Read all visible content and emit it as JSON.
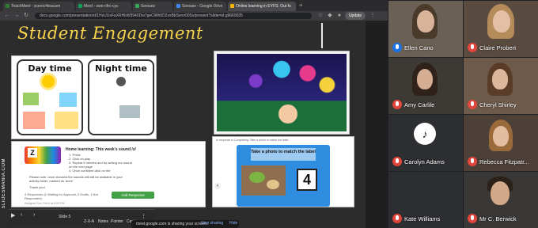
{
  "browser": {
    "tabs": [
      {
        "label": "TeachMeet - scenic4teacam",
        "color": "#2e7d32"
      },
      {
        "label": "Meet - swe-nfrc-cyc",
        "color": "#0f9d58"
      },
      {
        "label": "Seesaw",
        "color": "#34a853"
      },
      {
        "label": "Seesaw - Google Drive",
        "color": "#4285f4"
      },
      {
        "label": "Online learning in EYFS: Out fo",
        "color": "#f4b400"
      }
    ],
    "address": "docs.google.com/presentation/d/1HxUUxFaXRHkW9940Dw7geCWh6D2xxBbSvnn00Sv/present?slide=id.g9669035",
    "update_label": "Update"
  },
  "slide": {
    "title": "Student Engagement",
    "day_label": "Day time",
    "night_label": "Night time",
    "home_learning_title": "Home learning: This week's sound /z/",
    "home_learning_lines": [
      "1. Press",
      "2. Click on play",
      "3. Repeat if needed and try writing our sound on the next page",
      "4. Once confident click on the"
    ],
    "home_learning_footer": "Please note: once checked the sounds will still be available in your activity folder, marked as 'done'",
    "thank_you": "Thank you!",
    "responses_text": "4 Responses (1 Waiting for Approval, 0 Drafts, 1 Not Responded)",
    "add_response_label": "Add Response",
    "assigned_text": "Assigned Sun, Feb 6 at 6:00 PM",
    "response_caption": "In response to Completing: Take a photo to match the label",
    "photo_prompt": "Take a photo to match the label",
    "photo_number": "4",
    "side_label": "SLIDESMANIA.COM",
    "slide_number_label": "Slide 5"
  },
  "slide_toolbar": [
    "Z-X-A",
    "Notes",
    "Pointer",
    "Caption"
  ],
  "share_notice": "meet.google.com is sharing your screen.",
  "share_buttons": [
    "Stop sharing",
    "Hide"
  ],
  "participants": [
    {
      "name": "Ellen Cano",
      "muted": false
    },
    {
      "name": "Claire Probert",
      "muted": true
    },
    {
      "name": "Amy Carlile",
      "muted": true
    },
    {
      "name": "Cheryl Shirley",
      "muted": true
    },
    {
      "name": "Carolyn Adams",
      "muted": true
    },
    {
      "name": "Rebecca Fitzpatr...",
      "muted": true
    },
    {
      "name": "Kate Williams",
      "muted": true
    },
    {
      "name": "Mr C. Berwick",
      "muted": true
    }
  ],
  "colors": {
    "title": "#f7d24a",
    "muted_mic": "#e2453c",
    "active_mic": "#1a73e8"
  }
}
